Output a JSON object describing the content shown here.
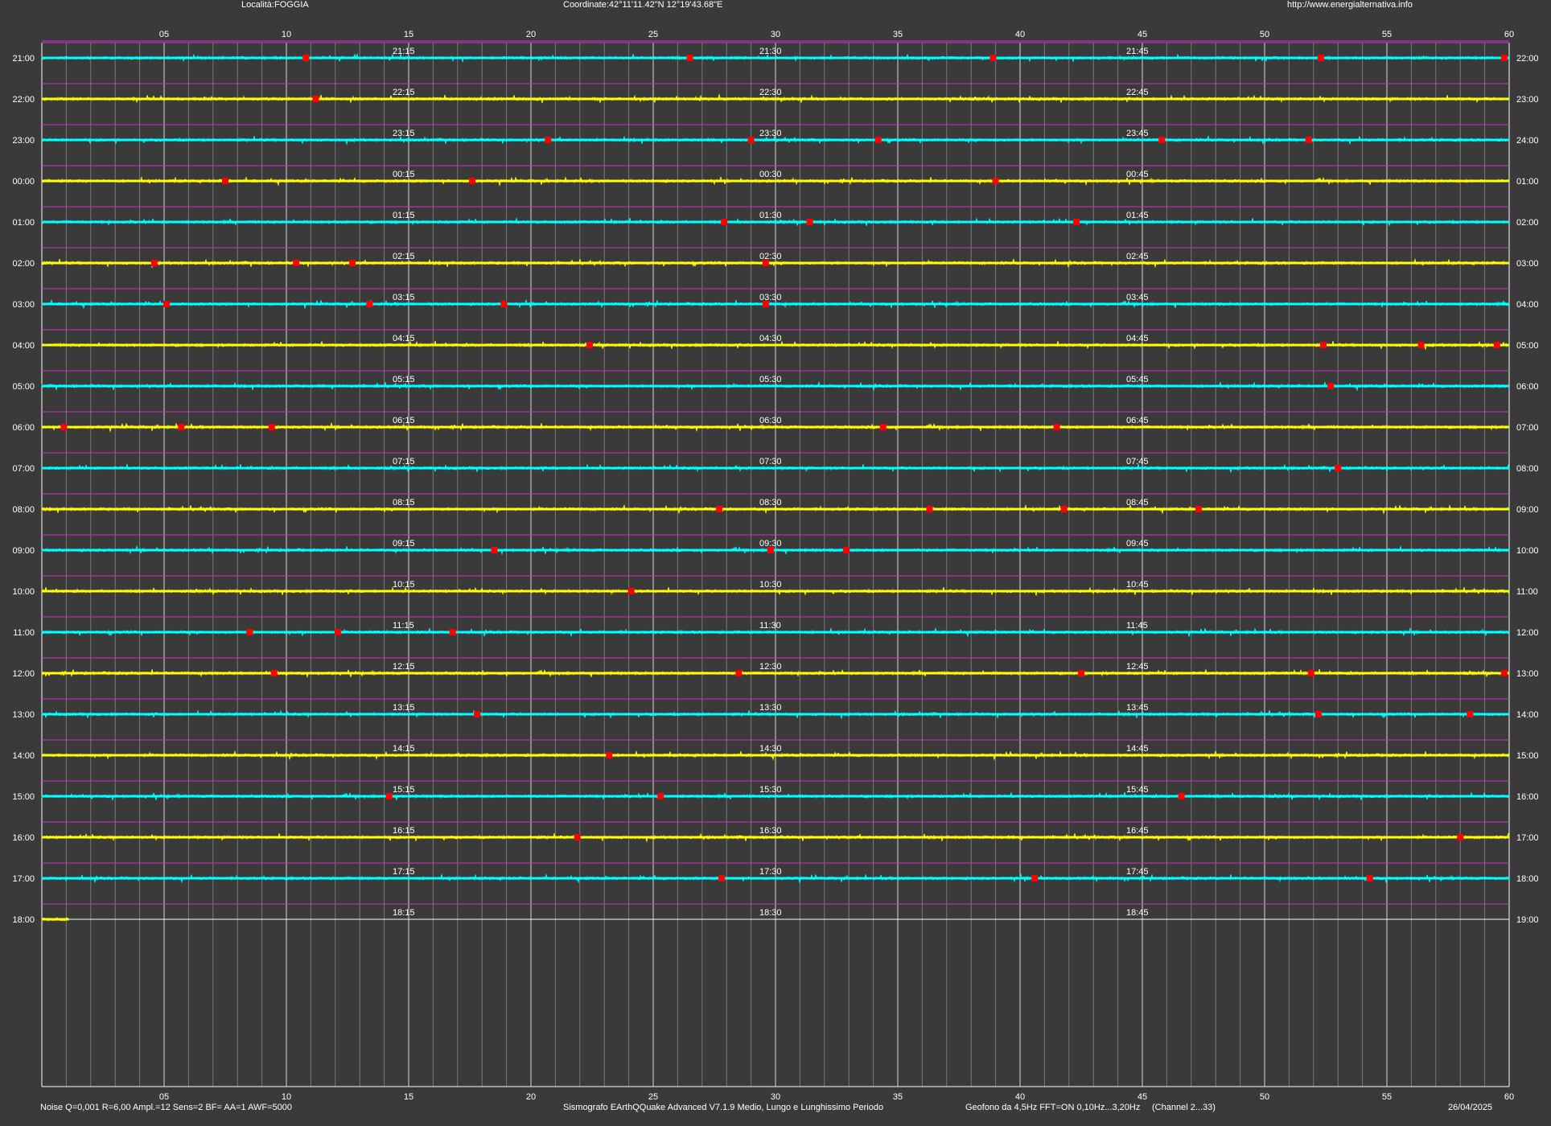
{
  "header": {
    "location": "Località:FOGGIA",
    "coordinates": "Coordinate:42°11'11.42\"N  12°19'43.68\"E",
    "url": "http://www.energialternativa.info"
  },
  "footer": {
    "params": "Noise Q=0,001 R=6,00 Ampl.=12 Sens=2 BF= AA=1 AWF=5000",
    "software": "Sismografo  EArthQQuake Advanced V7.1.9  Medio, Lungo e Lunghissimo Periodo",
    "sensor": "Geofono da 4,5Hz FFT=ON 0,10Hz...3,20Hz",
    "channel": "(Channel 2...33)",
    "date": "26/04/2025"
  },
  "colors": {
    "background": "#3a3a3a",
    "cyan_trace": "#00ffff",
    "yellow_trace": "#ffff00",
    "event_marker": "#ff0000",
    "row_separator": "#cc33cc",
    "grid_major": "#d8d8d8",
    "grid_minor": "#7a7a7a",
    "text": "#ffffff"
  },
  "chart_data": {
    "type": "line",
    "x_axis": {
      "unit": "minutes",
      "range": [
        0,
        60
      ],
      "tick_labels": [
        "05",
        "10",
        "15",
        "20",
        "25",
        "30",
        "35",
        "40",
        "45",
        "50",
        "55",
        "60"
      ],
      "tick_values": [
        5,
        10,
        15,
        20,
        25,
        30,
        35,
        40,
        45,
        50,
        55,
        60
      ]
    },
    "rows": [
      {
        "start": "21:00",
        "end": "22:00",
        "q15": "21:15",
        "q30": "21:30",
        "q45": "21:45",
        "color": "cyan",
        "events": [
          10.8,
          26.5,
          38.9,
          52.3,
          59.8
        ]
      },
      {
        "start": "22:00",
        "end": "23:00",
        "q15": "22:15",
        "q30": "22:30",
        "q45": "22:45",
        "color": "yellow",
        "events": [
          11.2
        ]
      },
      {
        "start": "23:00",
        "end": "24:00",
        "q15": "23:15",
        "q30": "23:30",
        "q45": "23:45",
        "color": "cyan",
        "events": [
          20.7,
          29.0,
          34.2,
          45.8,
          51.8
        ]
      },
      {
        "start": "00:00",
        "end": "01:00",
        "q15": "00:15",
        "q30": "00:30",
        "q45": "00:45",
        "color": "yellow",
        "events": [
          7.5,
          17.6,
          39.0
        ]
      },
      {
        "start": "01:00",
        "end": "02:00",
        "q15": "01:15",
        "q30": "01:30",
        "q45": "01:45",
        "color": "cyan",
        "events": [
          27.9,
          31.4,
          42.3
        ]
      },
      {
        "start": "02:00",
        "end": "03:00",
        "q15": "02:15",
        "q30": "02:30",
        "q45": "02:45",
        "color": "yellow",
        "events": [
          4.6,
          10.4,
          12.7,
          29.6
        ]
      },
      {
        "start": "03:00",
        "end": "04:00",
        "q15": "03:15",
        "q30": "03:30",
        "q45": "03:45",
        "color": "cyan",
        "events": [
          5.1,
          13.4,
          18.9,
          29.6
        ]
      },
      {
        "start": "04:00",
        "end": "05:00",
        "q15": "04:15",
        "q30": "04:30",
        "q45": "04:45",
        "color": "yellow",
        "events": [
          22.4,
          52.4,
          56.4,
          59.5
        ]
      },
      {
        "start": "05:00",
        "end": "06:00",
        "q15": "05:15",
        "q30": "05:30",
        "q45": "05:45",
        "color": "cyan",
        "events": [
          52.7
        ]
      },
      {
        "start": "06:00",
        "end": "07:00",
        "q15": "06:15",
        "q30": "06:30",
        "q45": "06:45",
        "color": "yellow",
        "events": [
          0.9,
          5.7,
          9.4,
          34.4,
          41.5
        ]
      },
      {
        "start": "07:00",
        "end": "08:00",
        "q15": "07:15",
        "q30": "07:30",
        "q45": "07:45",
        "color": "cyan",
        "events": [
          53.0
        ]
      },
      {
        "start": "08:00",
        "end": "09:00",
        "q15": "08:15",
        "q30": "08:30",
        "q45": "08:45",
        "color": "yellow",
        "events": [
          27.7,
          36.3,
          41.8,
          47.3
        ]
      },
      {
        "start": "09:00",
        "end": "10:00",
        "q15": "09:15",
        "q30": "09:30",
        "q45": "09:45",
        "color": "cyan",
        "events": [
          18.5,
          29.8,
          32.9
        ]
      },
      {
        "start": "10:00",
        "end": "11:00",
        "q15": "10:15",
        "q30": "10:30",
        "q45": "10:45",
        "color": "yellow",
        "events": [
          24.1
        ]
      },
      {
        "start": "11:00",
        "end": "12:00",
        "q15": "11:15",
        "q30": "11:30",
        "q45": "11:45",
        "color": "cyan",
        "events": [
          8.5,
          12.1,
          16.8
        ]
      },
      {
        "start": "12:00",
        "end": "13:00",
        "q15": "12:15",
        "q30": "12:30",
        "q45": "12:45",
        "color": "yellow",
        "events": [
          9.5,
          28.5,
          42.5,
          51.9,
          59.8
        ]
      },
      {
        "start": "13:00",
        "end": "14:00",
        "q15": "13:15",
        "q30": "13:30",
        "q45": "13:45",
        "color": "cyan",
        "events": [
          17.8,
          52.2,
          58.4
        ]
      },
      {
        "start": "14:00",
        "end": "15:00",
        "q15": "14:15",
        "q30": "14:30",
        "q45": "14:45",
        "color": "yellow",
        "events": [
          23.2
        ]
      },
      {
        "start": "15:00",
        "end": "16:00",
        "q15": "15:15",
        "q30": "15:30",
        "q45": "15:45",
        "color": "cyan",
        "events": [
          14.2,
          25.3,
          46.6
        ]
      },
      {
        "start": "16:00",
        "end": "17:00",
        "q15": "16:15",
        "q30": "16:30",
        "q45": "16:45",
        "color": "yellow",
        "events": [
          21.9,
          58.0
        ]
      },
      {
        "start": "17:00",
        "end": "18:00",
        "q15": "17:15",
        "q30": "17:30",
        "q45": "17:45",
        "color": "cyan",
        "events": [
          27.8,
          40.6,
          54.3
        ]
      },
      {
        "start": "18:00",
        "end": "19:00",
        "q15": "18:15",
        "q30": "18:30",
        "q45": "18:45",
        "color": "yellow",
        "events": [],
        "recorded_until": 1.1
      }
    ]
  }
}
